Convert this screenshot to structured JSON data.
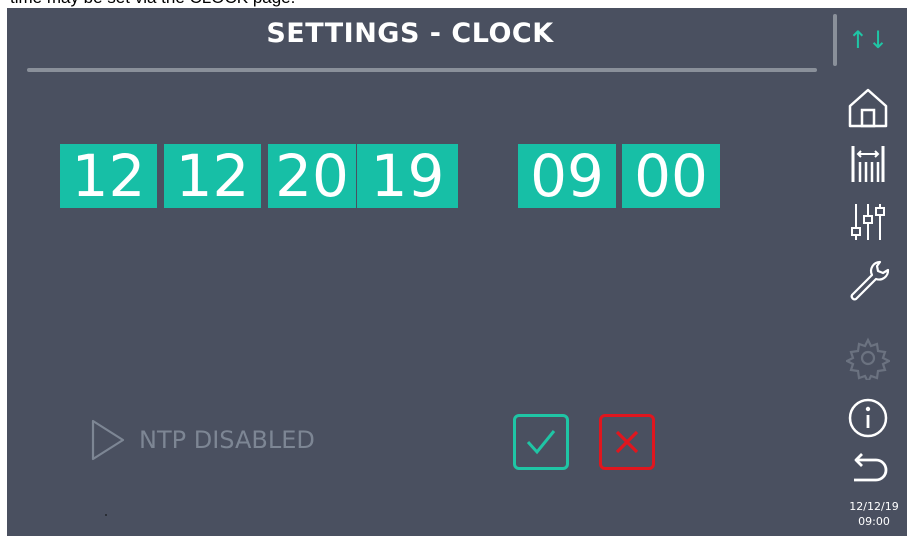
{
  "caption": "time may be set via the CLOCK page.",
  "header": {
    "title": "SETTINGS - CLOCK",
    "scroll_icon": "up-down-arrows-icon"
  },
  "datetime_fields": {
    "day": "12",
    "month": "12",
    "year_century": "20",
    "year_decade": "19",
    "hour": "09",
    "minute": "00"
  },
  "sidebar": {
    "items": [
      {
        "icon": "home-icon"
      },
      {
        "icon": "bar-gauge-icon"
      },
      {
        "icon": "sliders-icon"
      },
      {
        "icon": "wrench-icon"
      },
      {
        "icon": "gear-icon",
        "state": "disabled"
      },
      {
        "icon": "info-icon"
      },
      {
        "icon": "back-arrow-icon"
      }
    ]
  },
  "ntp": {
    "label": "NTP DISABLED",
    "icon": "play-triangle-icon"
  },
  "actions": {
    "confirm_icon": "check-icon",
    "cancel_icon": "close-icon"
  },
  "status_clock": {
    "date": "12/12/19",
    "time": "09:00"
  },
  "colors": {
    "background": "#4a5060",
    "accent": "#17bfa6",
    "confirm": "#1fc5a5",
    "cancel": "#e0161e",
    "muted": "#7d8694"
  }
}
